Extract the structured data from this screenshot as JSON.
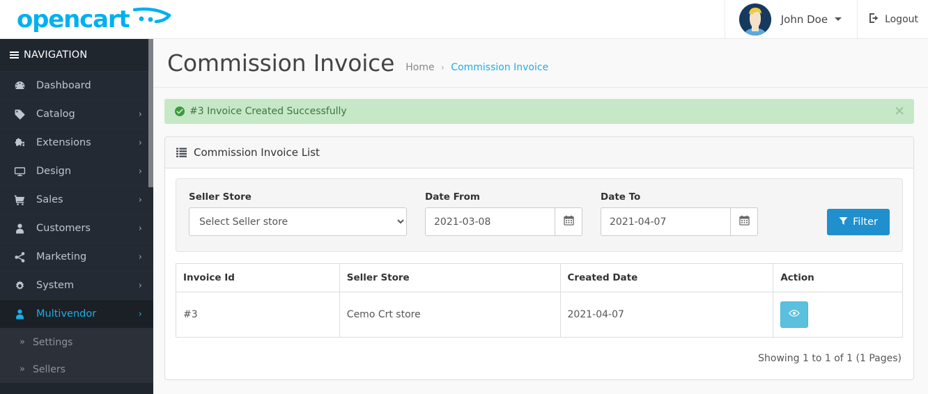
{
  "header": {
    "logo_text": "opencart",
    "logo_icon": "cart-swoosh-icon",
    "user_name": "John Doe",
    "logout_label": "Logout",
    "logout_icon": "sign-out-icon",
    "avatar_icon": "user-avatar"
  },
  "sidebar": {
    "nav_title": "NAVIGATION",
    "items": [
      {
        "label": "Dashboard",
        "icon": "dashboard-icon",
        "has_children": false,
        "active": false
      },
      {
        "label": "Catalog",
        "icon": "tag-icon",
        "has_children": true,
        "active": false
      },
      {
        "label": "Extensions",
        "icon": "puzzle-icon",
        "has_children": true,
        "active": false
      },
      {
        "label": "Design",
        "icon": "desktop-icon",
        "has_children": true,
        "active": false
      },
      {
        "label": "Sales",
        "icon": "cart-icon",
        "has_children": true,
        "active": false
      },
      {
        "label": "Customers",
        "icon": "user-icon",
        "has_children": true,
        "active": false
      },
      {
        "label": "Marketing",
        "icon": "share-icon",
        "has_children": true,
        "active": false
      },
      {
        "label": "System",
        "icon": "gear-icon",
        "has_children": true,
        "active": false
      },
      {
        "label": "Multivendor",
        "icon": "user-icon",
        "has_children": true,
        "active": true
      }
    ],
    "sub_items": [
      {
        "label": "Settings",
        "icon": "double-chevron-right-icon"
      },
      {
        "label": "Sellers",
        "icon": "double-chevron-right-icon"
      }
    ]
  },
  "page": {
    "title": "Commission Invoice",
    "breadcrumb": [
      {
        "label": "Home",
        "current": false
      },
      {
        "label": "Commission Invoice",
        "current": true
      }
    ],
    "breadcrumb_separator": "›"
  },
  "alert": {
    "icon": "check-circle-icon",
    "message": "#3 Invoice Created Successfully",
    "close_label": "×",
    "background": "#c6e8c6",
    "text_color": "#3c763d"
  },
  "panel": {
    "icon": "list-icon",
    "title": "Commission Invoice List"
  },
  "filter": {
    "seller_store": {
      "label": "Seller Store",
      "selected": "Select Seller store",
      "options": [
        "Select Seller store"
      ]
    },
    "date_from": {
      "label": "Date From",
      "value": "2021-03-08",
      "icon": "calendar-icon"
    },
    "date_to": {
      "label": "Date To",
      "value": "2021-04-07",
      "icon": "calendar-icon"
    },
    "button": {
      "label": "Filter",
      "icon": "funnel-icon",
      "color": "#208fce"
    }
  },
  "table": {
    "columns": [
      "Invoice Id",
      "Seller Store",
      "Created Date",
      "Action"
    ],
    "rows": [
      {
        "invoice_id": "#3",
        "seller_store": "Cemo Crt store",
        "created_date": "2021-04-07",
        "action_icon": "eye-icon",
        "action_color": "#5bc0de"
      }
    ],
    "footer": "Showing 1 to 1 of 1 (1 Pages)"
  }
}
